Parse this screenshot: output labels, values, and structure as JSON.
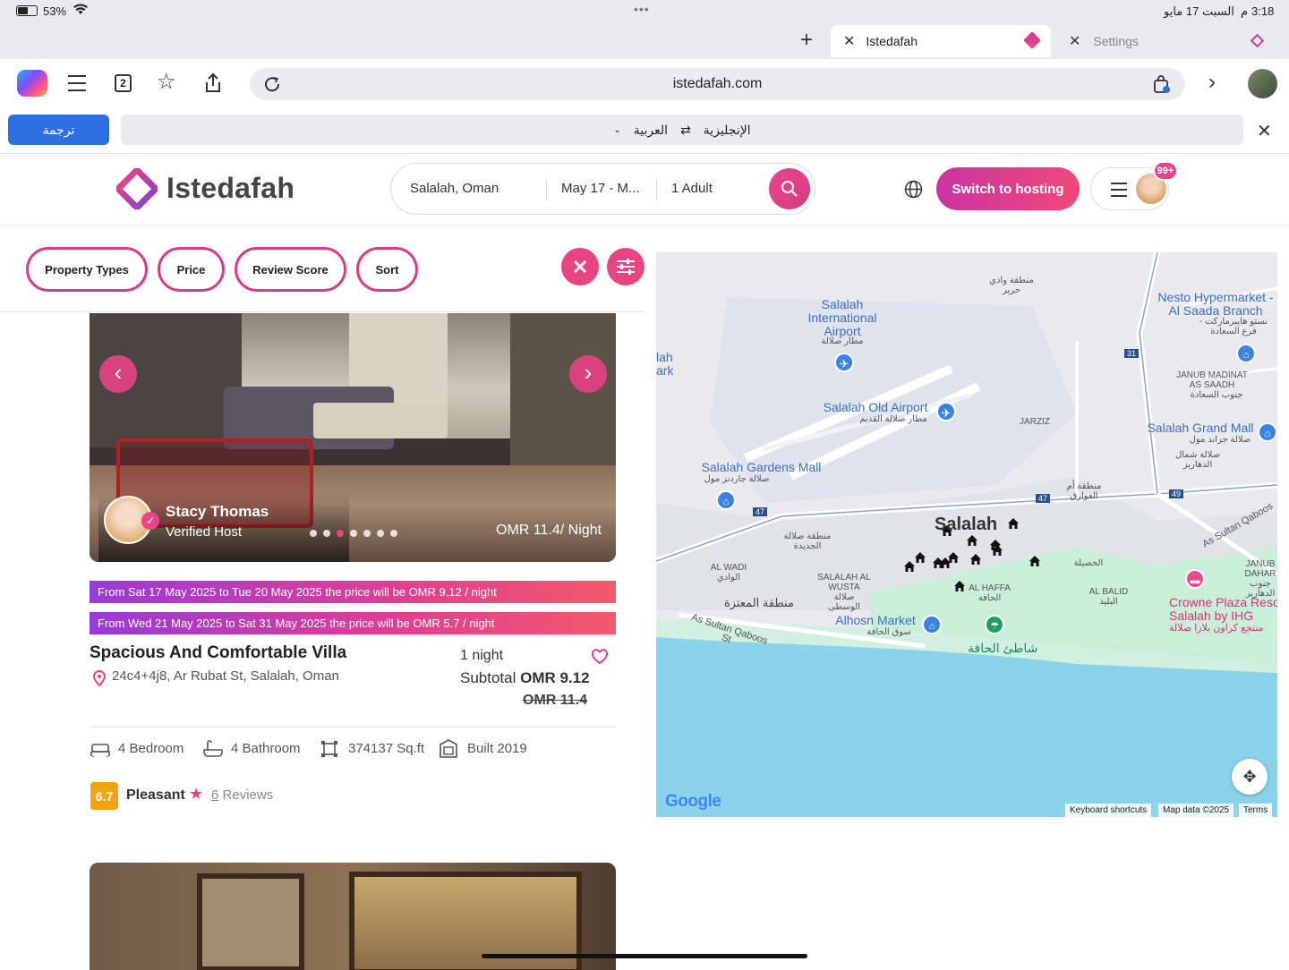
{
  "status_bar": {
    "battery": "53%",
    "time": "3:18",
    "date": "السبت 17 مايو",
    "ampm": "م",
    "dots": "•••"
  },
  "browser": {
    "tabs": [
      {
        "label": "Istedafah"
      },
      {
        "label": "Settings"
      }
    ],
    "tab_count": "2",
    "url": "istedafah.com"
  },
  "translate": {
    "button": "ترجمة",
    "from": "الإنجليزية",
    "to": "العربية",
    "swap": "⇄"
  },
  "header": {
    "logo": "Istedafah",
    "search": {
      "location": "Salalah, Oman",
      "dates": "May 17 - M...",
      "guests": "1 Adult"
    },
    "switch_label": "Switch to hosting",
    "badge": "99+"
  },
  "filters": {
    "items": [
      "Property Types",
      "Price",
      "Review Score",
      "Sort"
    ]
  },
  "listing": {
    "host_name": "Stacy Thomas",
    "host_status": "Verified Host",
    "price_per_night": "OMR 11.4/ Night",
    "promos": [
      "From Sat 17 May 2025 to Tue 20 May 2025 the price will be OMR 9.12 / night",
      "From Wed 21 May 2025 to Sat 31 May 2025 the price will be OMR 5.7 / night"
    ],
    "title": "Spacious And Comfortable Villa",
    "address": "24c4+4j8, Ar Rubat St, Salalah, Oman",
    "nights": "1 night",
    "subtotal_label": "Subtotal",
    "subtotal_value": "OMR 9.12",
    "old_price": "OMR 11.4",
    "amenities": [
      "4 Bedroom",
      "4 Bathroom",
      "374137 Sq.ft",
      "Built 2019"
    ],
    "rating_score": "6.7",
    "rating_label": "Pleasant",
    "reviews_count": "6",
    "reviews_label": "Reviews",
    "carousel_dots": 7,
    "active_dot": 2
  },
  "map": {
    "labels": {
      "wadi": "منطقة وادي حرير",
      "airport": "Salalah International Airport",
      "airport_ar": "مطار صلالة",
      "old_airport": "Salalah Old Airport",
      "old_airport_ar": "مطار صلالة القديم",
      "gardens": "Salalah Gardens Mall",
      "gardens_ar": "صلالة جاردنز مول",
      "nesto": "Nesto Hypermarket - Al Saada Branch",
      "nesto_ar": "نستو هايبرماركت - فرع السعادة",
      "janub": "JANUB MADINAT AS SAADH",
      "janub_ar": "جنوب السعادة",
      "jarziz": "JARZIZ",
      "grand_mall": "Salalah Grand Mall",
      "grand_mall_ar": "صلالة جراند مول",
      "shamal": "صلالة شمال الدهاريز",
      "awaqid": "منطقة أم العوارق",
      "salalah": "Salalah",
      "jadida": "منطقة صلالة الجديدة",
      "alwadi": "AL WADI الوادي",
      "wusta": "SALALAH AL WUSTA صلالة الوسطى",
      "hafah": "AL HAFFA الحافة",
      "husayla": "الحصيلة",
      "baleed": "AL BALID البليد",
      "muntaza": "منطقة المعتزة",
      "sultan1": "As Sultan Qaboos St",
      "sultan2": "As Sultan Qaboos",
      "alhosn": "Alhosn Market",
      "alhosn_ar": "سوق الحافة",
      "beach": "شاطئ الحافة",
      "dahariz": "JANUB DAHAR جنوب الدهاريز",
      "crowne": "Crowne Plaza Reso Salalah by IHG",
      "crowne_ar": "منتجع كراون بلازا صلالة",
      "park": "lah ark",
      "r31": "31",
      "r47a": "47",
      "r47b": "47",
      "r49": "49"
    },
    "footer": {
      "shortcuts": "Keyboard shortcuts",
      "data": "Map data ©2025",
      "terms": "Terms",
      "google": "Google"
    }
  },
  "colors": {
    "brand": "#e8457f",
    "promo_start": "#9a3ad8",
    "promo_end": "#f25a6a",
    "rating": "#f5a310",
    "link_blue": "#2f6fe4"
  }
}
